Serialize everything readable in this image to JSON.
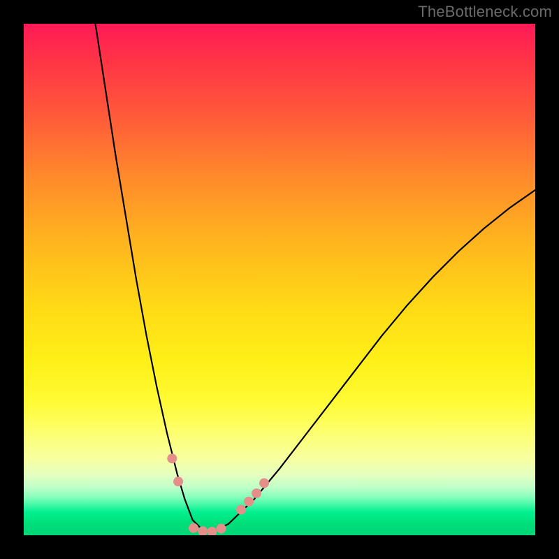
{
  "watermark": "TheBottleneck.com",
  "chart_data": {
    "type": "line",
    "title": "",
    "xlabel": "",
    "ylabel": "",
    "xlim": [
      0,
      100
    ],
    "ylim": [
      0,
      100
    ],
    "note": "No visible axes, ticks, or labels. V-shaped curve plotted over a vertical red→green gradient. Values are estimated from pixel positions; y=0 corresponds to the green bottom band, y=100 to the top red edge of the gradient area.",
    "series": [
      {
        "name": "main-curve",
        "color": "#000000",
        "x": [
          14,
          16,
          18,
          20,
          22,
          24,
          26,
          28,
          30,
          31.5,
          33,
          35,
          37,
          40,
          45,
          50,
          55,
          60,
          65,
          70,
          75,
          80,
          85,
          90,
          95,
          100
        ],
        "y": [
          100,
          87,
          74,
          62,
          50,
          39,
          29,
          20,
          12,
          7,
          3,
          1,
          0.7,
          2.2,
          7,
          13,
          19.5,
          26,
          32.5,
          39,
          45,
          50.5,
          55.5,
          60,
          64,
          67.5
        ]
      }
    ],
    "markers": [
      {
        "name": "left-data-points",
        "color": "#e58f8a",
        "radius_px": 7,
        "points": [
          {
            "x": 29.0,
            "y": 15.0
          },
          {
            "x": 30.2,
            "y": 10.5
          }
        ]
      },
      {
        "name": "valley-data-points",
        "color": "#e58f8a",
        "radius_px": 7,
        "points": [
          {
            "x": 33.2,
            "y": 1.4
          },
          {
            "x": 35.0,
            "y": 0.8
          },
          {
            "x": 36.8,
            "y": 0.7
          },
          {
            "x": 38.6,
            "y": 1.3
          }
        ]
      },
      {
        "name": "right-data-points",
        "color": "#e58f8a",
        "radius_px": 7,
        "points": [
          {
            "x": 42.5,
            "y": 5.0
          },
          {
            "x": 44.0,
            "y": 6.6
          },
          {
            "x": 45.5,
            "y": 8.2
          },
          {
            "x": 47.0,
            "y": 10.2
          }
        ]
      }
    ]
  },
  "colors": {
    "background": "#000000",
    "gradient_top": "#ff1a57",
    "gradient_bottom": "#00d776",
    "curve": "#000000",
    "marker_fill": "#e58f8a",
    "watermark": "#6a6a6a"
  }
}
